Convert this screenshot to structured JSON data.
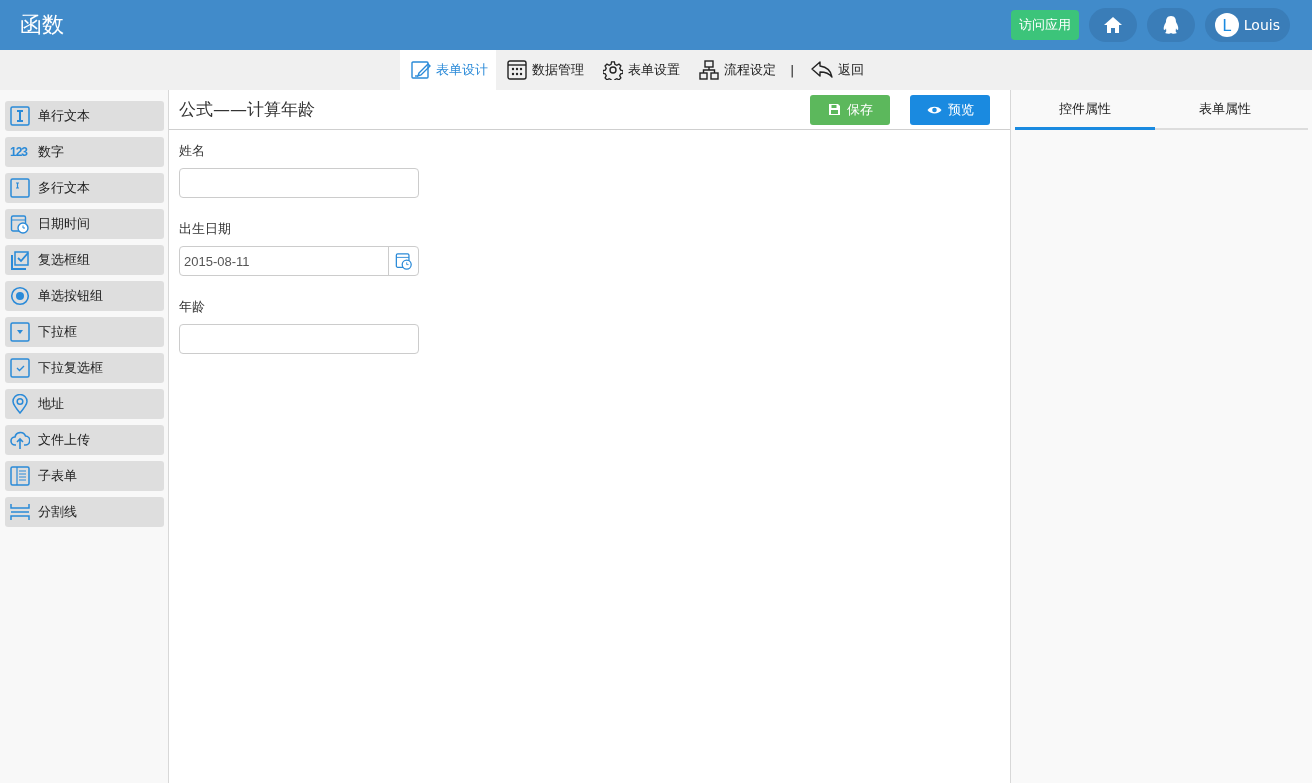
{
  "header": {
    "title": "函数",
    "visit_button": "访问应用",
    "user": {
      "initial": "L",
      "name": "Louis"
    }
  },
  "nav": {
    "tabs": [
      {
        "label": "表单设计",
        "kind": "edit",
        "selected": true
      },
      {
        "label": "数据管理",
        "kind": "grid",
        "selected": false
      },
      {
        "label": "表单设置",
        "kind": "gear",
        "selected": false
      },
      {
        "label": "流程设定",
        "kind": "flow",
        "selected": false
      }
    ],
    "separator": "|",
    "back": "返回"
  },
  "palette": [
    {
      "label": "单行文本",
      "kind": "text"
    },
    {
      "label": "数字",
      "kind": "number",
      "icon_text": "123"
    },
    {
      "label": "多行文本",
      "kind": "textarea"
    },
    {
      "label": "日期时间",
      "kind": "datetime"
    },
    {
      "label": "复选框组",
      "kind": "checkbox"
    },
    {
      "label": "单选按钮组",
      "kind": "radio"
    },
    {
      "label": "下拉框",
      "kind": "select"
    },
    {
      "label": "下拉复选框",
      "kind": "multiselect"
    },
    {
      "label": "地址",
      "kind": "address"
    },
    {
      "label": "文件上传",
      "kind": "upload"
    },
    {
      "label": "子表单",
      "kind": "subform"
    },
    {
      "label": "分割线",
      "kind": "divider"
    }
  ],
  "form": {
    "title": "公式——计算年龄",
    "save": "保存",
    "preview": "预览",
    "fields": [
      {
        "label": "姓名",
        "kind": "text"
      },
      {
        "label": "出生日期",
        "kind": "date",
        "value": "2015-08-11"
      },
      {
        "label": "年龄",
        "kind": "text"
      }
    ]
  },
  "properties": {
    "tabs": [
      {
        "label": "控件属性",
        "selected": true
      },
      {
        "label": "表单属性",
        "selected": false
      }
    ]
  }
}
